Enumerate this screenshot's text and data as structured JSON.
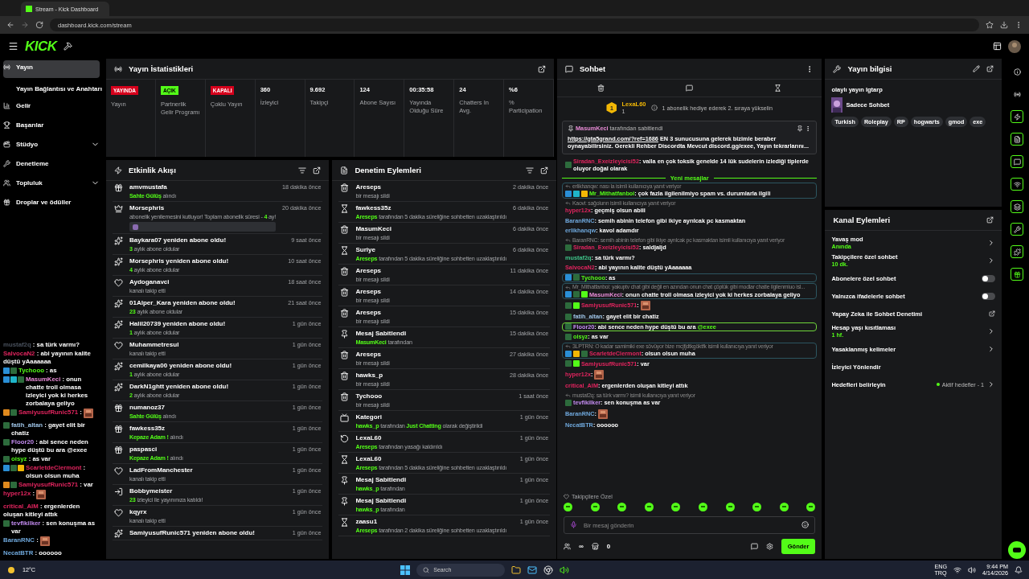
{
  "browser": {
    "tab_title": "Stream - Kick Dashboard",
    "url": "dashboard.kick.com/stream"
  },
  "header": {
    "logo": "KICK"
  },
  "sidebar": {
    "items": [
      {
        "label": "Yayın",
        "selected": true,
        "children": [
          {
            "label": "Yayın Bağlantısı ve Anahtarı",
            "selected": false
          }
        ]
      },
      {
        "label": "Gelir",
        "selected": false
      },
      {
        "label": "Başarılar",
        "selected": false
      },
      {
        "label": "Stüdyo",
        "selected": false,
        "expanded": false
      },
      {
        "label": "Denetleme",
        "selected": false
      },
      {
        "label": "Topluluk",
        "selected": false,
        "expanded": false
      },
      {
        "label": "Droplar ve ödüller",
        "selected": false
      }
    ]
  },
  "stream_overlay": {
    "lines": [
      {
        "name": "mustaf2q",
        "color": "#4a525e",
        "text": ": sa türk varmı?"
      },
      {
        "name": "SalvocaN2",
        "color": "#e0245e",
        "text": ": abi yayının kalite düştü yAaaaaaa"
      },
      {
        "name": "Tychooo",
        "color": "#53fc18",
        "text": ": as",
        "badges": [
          {
            "kind": "mod"
          },
          {
            "kind": "vip"
          }
        ]
      },
      {
        "name": "MasumKeci",
        "color": "#e88bd6",
        "text": ": onun chatte troll olmasa izleyici yok ki herkes zorbalaya geliyo",
        "badges": [
          {
            "kind": "mod"
          },
          {
            "kind": "gem"
          },
          {
            "kind": "vip"
          }
        ]
      },
      {
        "name": "SamiyusufRunic571",
        "color": "#e0245e",
        "text": ":",
        "badges": [
          {
            "kind": "box"
          },
          {
            "kind": "vip"
          }
        ],
        "emote": true
      },
      {
        "name": "fatih_altan",
        "color": "#9fc5e8",
        "text": ": gayet elit bir chatiz",
        "badges": [
          {
            "kind": "vip"
          }
        ]
      },
      {
        "name": "Floor20",
        "color": "#c38bf0",
        "text": ": abi sence neden hype düştü bu ara @exee",
        "badges": [
          {
            "kind": "vip"
          }
        ]
      },
      {
        "name": "oisyz",
        "color": "#53fc18",
        "text": ": as var",
        "badges": [
          {
            "kind": "vip"
          }
        ]
      },
      {
        "name": "ScarletdeClermont",
        "color": "#e0245e",
        "text": ": olsun olsun muha",
        "badges": [
          {
            "kind": "mod"
          },
          {
            "kind": "vip"
          },
          {
            "kind": "crown"
          }
        ]
      },
      {
        "name": "SamiyusufRunic571",
        "color": "#e0245e",
        "text": ": var",
        "badges": [
          {
            "kind": "box"
          },
          {
            "kind": "vip"
          }
        ]
      },
      {
        "name": "hyper12x",
        "color": "#e0245e",
        "text": ":",
        "emote": true
      },
      {
        "name": "critical_AIM",
        "color": "#e0245e",
        "text": ": ergenlerden oluşan kitleyi attık"
      },
      {
        "name": "tevfikilker",
        "color": "#c38bf0",
        "text": ": sen konuşma as var",
        "badges": [
          {
            "kind": "vip"
          }
        ]
      },
      {
        "name": "BaranRNC",
        "color": "#6fa8dc",
        "text": ":",
        "emote": true
      },
      {
        "name": "NecatBTR",
        "color": "#6fa8dc",
        "text": ": oooooo"
      }
    ]
  },
  "stream_stats": {
    "title": "Yayın İstatistikleri",
    "stats": [
      {
        "kind": "badge",
        "value": "YAYINDA",
        "color": "#d6001c",
        "label": "Yayın"
      },
      {
        "kind": "badge",
        "value": "AÇIK",
        "color": "#53fc18",
        "label": "Partnerlik Gelir Programı"
      },
      {
        "kind": "badge",
        "value": "KAPALI",
        "color": "#d6001c",
        "label": "Çoklu Yayın"
      },
      {
        "kind": "number",
        "value": "360",
        "label": "İzleyici"
      },
      {
        "kind": "number",
        "value": "9.692",
        "label": "Takipçi"
      },
      {
        "kind": "number",
        "value": "124",
        "label": "Abone Sayısı"
      },
      {
        "kind": "number",
        "value": "00:35:58",
        "label": "Yayında Olduğu Süre"
      },
      {
        "kind": "number",
        "value": "24",
        "label": "Chatters In Avg."
      },
      {
        "kind": "number",
        "value": "%6",
        "label": "% Participation"
      }
    ]
  },
  "activity_feed": {
    "title": "Etkinlik Akışı",
    "items": [
      {
        "kind": "gift",
        "title": "amvmustafa",
        "time": "18 dakika önce",
        "parts": [
          {
            "text": "Sahte Gülüş",
            "accent": true
          },
          {
            "text": " alındı",
            "accent": false
          }
        ]
      },
      {
        "kind": "sub",
        "title": "Morsephris",
        "time": "20 dakika önce",
        "parts": [
          {
            "text": "abonelik yenilemesini kutluyor! Toplam abonelik süresi - ",
            "accent": false
          },
          {
            "text": "4",
            "accent": true
          },
          {
            "text": " ay!",
            "accent": false
          }
        ],
        "message_emote": true
      },
      {
        "kind": "resub",
        "title": "Baykara07 yeniden abone oldu!",
        "time": "9 saat önce",
        "parts": [
          {
            "text": "3",
            "accent": true
          },
          {
            "text": " aylık abone oldular",
            "accent": false
          }
        ]
      },
      {
        "kind": "resub",
        "title": "Morsephris yeniden abone oldu!",
        "time": "10 saat önce",
        "parts": [
          {
            "text": "4",
            "accent": true
          },
          {
            "text": " aylık abone oldular",
            "accent": false
          }
        ]
      },
      {
        "kind": "follow",
        "title": "Aydoganavci",
        "time": "18 saat önce",
        "parts": [
          {
            "text": "kanalı takip etti",
            "accent": false
          }
        ]
      },
      {
        "kind": "resub",
        "title": "01Alper_Kara yeniden abone oldu!",
        "time": "21 saat önce",
        "parts": [
          {
            "text": "23",
            "accent": true
          },
          {
            "text": " aylık abone oldular",
            "accent": false
          }
        ]
      },
      {
        "kind": "resub",
        "title": "Halil20739 yeniden abone oldu!",
        "time": "1 gün önce",
        "parts": [
          {
            "text": "1",
            "accent": true
          },
          {
            "text": " aylık abone oldular",
            "accent": false
          }
        ]
      },
      {
        "kind": "follow",
        "title": "Muhammetresul",
        "time": "1 gün önce",
        "parts": [
          {
            "text": "kanalı takip etti",
            "accent": false
          }
        ]
      },
      {
        "kind": "resub",
        "title": "cemilkaya00 yeniden abone oldu!",
        "time": "1 gün önce",
        "parts": [
          {
            "text": "1",
            "accent": true
          },
          {
            "text": " aylık abone oldular",
            "accent": false
          }
        ]
      },
      {
        "kind": "resub",
        "title": "DarkN1ghtt yeniden abone oldu!",
        "time": "1 gün önce",
        "parts": [
          {
            "text": "2",
            "accent": true
          },
          {
            "text": " aylık abone oldular",
            "accent": false
          }
        ]
      },
      {
        "kind": "gift",
        "title": "numanoz37",
        "time": "1 gün önce",
        "parts": [
          {
            "text": "Sahte Gülüş",
            "accent": true
          },
          {
            "text": " alındı",
            "accent": false
          }
        ]
      },
      {
        "kind": "gift",
        "title": "fawkess35z",
        "time": "1 gün önce",
        "parts": [
          {
            "text": "Kepaze Adam !",
            "accent": true
          },
          {
            "text": " alındı",
            "accent": false
          }
        ]
      },
      {
        "kind": "gift",
        "title": "paspasci",
        "time": "1 gün önce",
        "parts": [
          {
            "text": "Kepaze Adam !",
            "accent": true
          },
          {
            "text": " alındı",
            "accent": false
          }
        ]
      },
      {
        "kind": "follow",
        "title": "LadFromManchester",
        "time": "1 gün önce",
        "parts": [
          {
            "text": "kanalı takip etti",
            "accent": false
          }
        ]
      },
      {
        "kind": "host",
        "title": "Bobbymeister",
        "time": "1 gün önce",
        "parts": [
          {
            "text": "23",
            "accent": true
          },
          {
            "text": " izleyici ile yayınınıza katıldı!",
            "accent": false
          }
        ]
      },
      {
        "kind": "follow",
        "title": "kqyrx",
        "time": "1 gün önce",
        "parts": [
          {
            "text": "kanalı takip etti",
            "accent": false
          }
        ]
      },
      {
        "kind": "resub",
        "title": "SamiyusufRunic571 yeniden abone oldu!",
        "time": "1 gün önce"
      }
    ]
  },
  "mod_actions": {
    "title": "Denetim Eylemleri",
    "items": [
      {
        "kind": "delete",
        "title": "Areseps",
        "time": "2 dakika önce",
        "parts": [
          {
            "text": "bir mesajı sildi",
            "accent": false
          }
        ]
      },
      {
        "kind": "timeout",
        "title": "fawkess35z",
        "time": "6 dakika önce",
        "parts": [
          {
            "text": "Areseps",
            "accent": true
          },
          {
            "text": " tarafından 5 dakika süreliğine sohbetten uzaklaştırıldı",
            "accent": false
          }
        ]
      },
      {
        "kind": "delete",
        "title": "MasumKeci",
        "time": "6 dakika önce",
        "parts": [
          {
            "text": "bir mesajı sildi",
            "accent": false
          }
        ]
      },
      {
        "kind": "timeout",
        "title": "Suriye",
        "time": "6 dakika önce",
        "parts": [
          {
            "text": "Areseps",
            "accent": true
          },
          {
            "text": " tarafından 5 dakika süreliğine sohbetten uzaklaştırıldı",
            "accent": false
          }
        ]
      },
      {
        "kind": "delete",
        "title": "Areseps",
        "time": "11 dakika önce",
        "parts": [
          {
            "text": "bir mesajı sildi",
            "accent": false
          }
        ]
      },
      {
        "kind": "delete",
        "title": "Areseps",
        "time": "14 dakika önce",
        "parts": [
          {
            "text": "bir mesajı sildi",
            "accent": false
          }
        ]
      },
      {
        "kind": "delete",
        "title": "Areseps",
        "time": "15 dakika önce",
        "parts": [
          {
            "text": "bir mesajı sildi",
            "accent": false
          }
        ]
      },
      {
        "kind": "pin",
        "title": "Mesaj Sabitlendi",
        "time": "15 dakika önce",
        "parts": [
          {
            "text": "MasumKeci",
            "accent": true
          },
          {
            "text": " tarafından",
            "accent": false
          }
        ]
      },
      {
        "kind": "delete",
        "title": "Areseps",
        "time": "27 dakika önce",
        "parts": [
          {
            "text": "bir mesajı sildi",
            "accent": false
          }
        ]
      },
      {
        "kind": "delete",
        "title": "hawks_p",
        "time": "28 dakika önce",
        "parts": [
          {
            "text": "bir mesajı sildi",
            "accent": false
          }
        ]
      },
      {
        "kind": "delete",
        "title": "Tychooo",
        "time": "1 saat önce",
        "parts": [
          {
            "text": "bir mesajı sildi",
            "accent": false
          }
        ]
      },
      {
        "kind": "category",
        "title": "Kategori",
        "time": "1 gün önce",
        "parts": [
          {
            "text": "hawks_p",
            "accent": true
          },
          {
            "text": " tarafından ",
            "accent": false
          },
          {
            "text": "Just Chatting",
            "accent": true
          },
          {
            "text": " olarak değiştirildi",
            "accent": false
          }
        ]
      },
      {
        "kind": "unban",
        "title": "LexaL60",
        "time": "1 gün önce",
        "parts": [
          {
            "text": "Areseps",
            "accent": true
          },
          {
            "text": " tarafından yasağı kaldırıldı",
            "accent": false
          }
        ]
      },
      {
        "kind": "timeout",
        "title": "LexaL60",
        "time": "1 gün önce",
        "parts": [
          {
            "text": "Areseps",
            "accent": true
          },
          {
            "text": " tarafından 5 dakika süreliğine sohbetten uzaklaştırıldı",
            "accent": false
          }
        ]
      },
      {
        "kind": "pin",
        "title": "Mesaj Sabitlendi",
        "time": "1 gün önce",
        "parts": [
          {
            "text": "hawks_p",
            "accent": true
          },
          {
            "text": " tarafından",
            "accent": false
          }
        ]
      },
      {
        "kind": "pin",
        "title": "Mesaj Sabitlendi",
        "time": "1 gün önce",
        "parts": [
          {
            "text": "hawks_p",
            "accent": true
          },
          {
            "text": " tarafından",
            "accent": false
          }
        ]
      },
      {
        "kind": "timeout",
        "title": "zaasu1",
        "time": "1 gün önce",
        "parts": [
          {
            "text": "Areseps",
            "accent": true
          },
          {
            "text": " tarafından 2 dakika süreliğine sohbetten uzaklaştırıldı",
            "accent": false
          }
        ]
      }
    ]
  },
  "chat": {
    "title": "Sohbet",
    "leader": {
      "rank": "1",
      "name": "LexaL60",
      "count": "1",
      "hint": "1 abonelik hediye ederek 2. sıraya yükselin"
    },
    "pinned": {
      "by": "MasumKeci",
      "by_text": " tarafından sabitlendi",
      "link": "https://gta5grand.com/?ref=1686",
      "text": " EN 3 sunucusuna gelerek bizimle beraber oynayabilirsiniz. Gerekli Rehber Discordta Mevcut discord.gg/exee, Yayın tekrarlarını..."
    },
    "messages": [
      {
        "kind": "text",
        "name": "Siradan_Exeizleyicisi52",
        "color": "#e0245e",
        "text": ": valla en çok toksik genelde 14 lük sudelerin izlediği tiplerde oluyor doğal olarak",
        "badges": [
          {
            "kind": "vip"
          }
        ]
      },
      {
        "kind": "divider",
        "text": "Yeni mesajlar"
      },
      {
        "kind": "text",
        "reply": "erlikhanqw: nası la isimli kullanıcıya yanıt veriyor",
        "framed": true,
        "name": "Mr_Mithatfanboi",
        "color": "#53fc18",
        "text": ": çok fazla ilgilenilmiyo spam vs. durumlarla ilgili",
        "badges": [
          {
            "kind": "mod"
          },
          {
            "kind": "gem"
          },
          {
            "kind": "coin"
          }
        ]
      },
      {
        "kind": "text",
        "reply": "Kaovi: sağolunn isimli kullanıcıya yanıt veriyor",
        "name": "hyper12x",
        "color": "#e0245e",
        "text": ": geçmiş olsun abiii"
      },
      {
        "kind": "text",
        "name": "BaranRNC",
        "color": "#6fa8dc",
        "text": ": semih abinin telefon gibi ikiye ayrılcak pc kasmaktan"
      },
      {
        "kind": "text",
        "name": "erlikhanqw",
        "color": "#6fa8dc",
        "text": ": kavol adamdır"
      },
      {
        "kind": "text",
        "reply": "BaranRNC: semih abinin telefon gibi ikiye ayrılcak pc kasmaktan isimli kullanıcıya yanıt veriyor",
        "name": "Siradan_Exeizleyicisi52",
        "color": "#e0245e",
        "text": ": saldjaljd",
        "badges": [
          {
            "kind": "vip"
          }
        ]
      },
      {
        "kind": "text",
        "name": "mustaf2q",
        "color": "#3fc58a",
        "text": ": sa türk varmı?"
      },
      {
        "kind": "text",
        "name": "SalvocaN2",
        "color": "#e0245e",
        "text": ": abi yayının kalite düştü yAaaaaaa"
      },
      {
        "kind": "text",
        "framed": true,
        "name": "Tychooo",
        "color": "#53fc18",
        "text": ": as",
        "badges": [
          {
            "kind": "mod"
          },
          {
            "kind": "vip"
          }
        ]
      },
      {
        "kind": "text",
        "reply": "Mr_Mithatfanboi: yakuptv chat gibi değil en azından onun chat çöplük gibi modlar chatle ilgilenmiuo isl...",
        "framed": true,
        "name": "MasumKeci",
        "color": "#e88bd6",
        "text": ": onun chatte troll olmasa izleyici yok ki herkes zorbalaya geliyo",
        "badges": [
          {
            "kind": "mod"
          },
          {
            "kind": "vip"
          },
          {
            "kind": "sub"
          }
        ]
      },
      {
        "kind": "emote",
        "name": "SamiyusufRunic571",
        "color": "#e0245e",
        "text": ":",
        "badges": [
          {
            "kind": "vip"
          },
          {
            "kind": "sub"
          }
        ]
      },
      {
        "kind": "text",
        "name": "fatih_altan",
        "color": "#9fc5e8",
        "text": ": gayet elit bir chatiz",
        "badges": [
          {
            "kind": "vip"
          }
        ]
      },
      {
        "kind": "text",
        "framed": true,
        "name": "Floor20",
        "color": "#c38bf0",
        "text": ": abi sence neden hype düştü bu ara ",
        "mention": "@exee",
        "badges": [
          {
            "kind": "vip"
          }
        ]
      },
      {
        "kind": "text",
        "name": "oisyz",
        "color": "#53fc18",
        "text": ": as var",
        "badges": [
          {
            "kind": "vip"
          }
        ]
      },
      {
        "kind": "text",
        "reply": "3LPTRN: O kadar samimiki exe sövüyor bize mcjfjdtkgöktfk isimli kullanıcıya yanıt veriyor",
        "framed": true,
        "name": "ScarletdeClermont",
        "color": "#e0245e",
        "text": ": olsun olsun muha",
        "badges": [
          {
            "kind": "mod"
          },
          {
            "kind": "crown"
          },
          {
            "kind": "vip"
          }
        ]
      },
      {
        "kind": "text",
        "name": "SamiyusufRunic571",
        "color": "#e0245e",
        "text": ": var",
        "badges": [
          {
            "kind": "vip"
          },
          {
            "kind": "sub"
          }
        ]
      },
      {
        "kind": "emote",
        "name": "hyper12x",
        "color": "#e0245e",
        "text": ":"
      },
      {
        "kind": "text",
        "name": "critical_AIM",
        "color": "#e0245e",
        "text": ": ergenlerden oluşan kitleyi attık"
      },
      {
        "kind": "text",
        "reply": "mustaf2q: sa türk varmı? isimli kullanıcıya yanıt veriyor",
        "name": "tevfikilker",
        "color": "#c38bf0",
        "text": ": sen konuşma as var",
        "badges": [
          {
            "kind": "vip"
          }
        ]
      },
      {
        "kind": "emote",
        "name": "BaranRNC",
        "color": "#6fa8dc",
        "text": ":"
      },
      {
        "kind": "text",
        "name": "NecatBTR",
        "color": "#6fa8dc",
        "text": ": oooooo"
      }
    ],
    "emote_bar": {
      "label": "Takipçilere Özel"
    },
    "input": {
      "placeholder": "Bir mesaj gönderin"
    },
    "footer": {
      "infinity": "∞",
      "count": "0",
      "send": "Gönder"
    }
  },
  "stream_info": {
    "title": "Yayın bilgisi",
    "stream_title": "olaylı yayın Igtarp",
    "category": "Sadece Sohbet",
    "tags": [
      "Turkish",
      "Roleplay",
      "RP",
      "hogwarts",
      "gmod",
      "exe"
    ]
  },
  "channel_actions": {
    "title": "Kanal Eylemleri",
    "items": [
      {
        "kind": "link",
        "label": "Yavaş mod",
        "value": "Anında"
      },
      {
        "kind": "link",
        "label": "Takipçilere özel sohbet",
        "value": "10 dk."
      },
      {
        "kind": "toggle",
        "label": "Abonelere özel sohbet",
        "on": false
      },
      {
        "kind": "toggle",
        "label": "Yalnızca ifadelerle sohbet",
        "on": false
      },
      {
        "kind": "external",
        "label": "Yapay Zeka ile Sohbet Denetimi"
      },
      {
        "kind": "link",
        "label": "Hesap yaşı kısıtlaması",
        "value": "1 hf."
      },
      {
        "kind": "link",
        "label": "Yasaklanmış kelimeler"
      },
      {
        "kind": "plain",
        "label": "İzleyici Yönlendir"
      },
      {
        "kind": "link",
        "label": "Hedefleri belirleyin",
        "note": "Aktif hedefler - 1"
      }
    ]
  },
  "taskbar": {
    "weather": "12°C",
    "search": "Search",
    "lang": "ENG",
    "layout": "TRQ",
    "time": "9:44 PM",
    "date": "4/14/2026"
  }
}
